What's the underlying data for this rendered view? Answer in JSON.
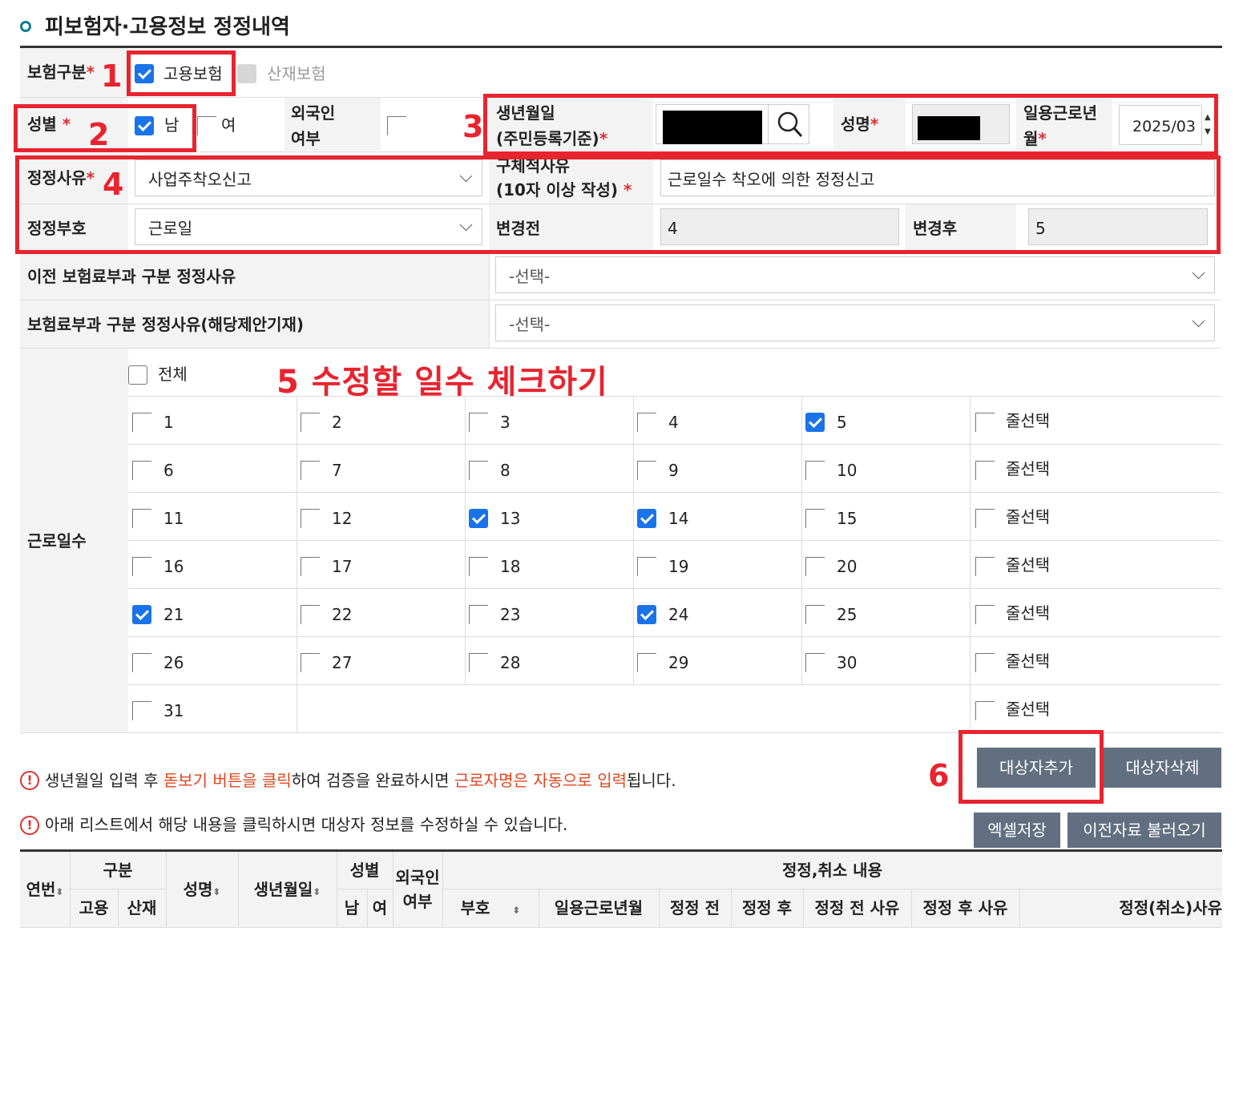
{
  "section": {
    "title": "피보험자·고용정보 정정내역"
  },
  "insurance": {
    "label": "보험구분",
    "required_mark": "*",
    "employment": {
      "label": "고용보험",
      "checked": true
    },
    "industrial": {
      "label": "산재보험",
      "checked": false,
      "disabled": true
    }
  },
  "gender": {
    "label": "성별",
    "required_mark": "*",
    "male": {
      "label": "남",
      "checked": true
    },
    "female": {
      "label": "여",
      "checked": false
    }
  },
  "foreigner": {
    "label_line1": "외국인",
    "label_line2": "여부"
  },
  "birth": {
    "label_line1": "생년월일",
    "label_line2": "(주민등록기준)",
    "required_mark": "*"
  },
  "name_field": {
    "label": "성명",
    "required_mark": "*"
  },
  "work_month": {
    "label_line1": "일용근로년",
    "label_line2": "월",
    "required_mark": "*",
    "value": "2025/03"
  },
  "reason": {
    "label": "정정사유",
    "required_mark": "*",
    "selected": "사업주착오신고"
  },
  "detail_reason": {
    "label_line1": "구체적사유",
    "label_line2": "(10자 이상 작성)",
    "required_mark": "*",
    "value": "근로일수 착오에 의한 정정신고"
  },
  "code": {
    "label": "정정부호",
    "selected": "근로일"
  },
  "before": {
    "label": "변경전",
    "value": "4"
  },
  "after": {
    "label": "변경후",
    "value": "5"
  },
  "prev_reason": {
    "label": "이전 보험료부과 구분 정정사유",
    "selected": "-선택-"
  },
  "cur_reason": {
    "label": "보험료부과 구분 정정사유(해당제안기재)",
    "selected": "-선택-"
  },
  "workdays": {
    "label": "근로일수",
    "all_label": "전체",
    "row_select_label": "줄선택",
    "checked_days": [
      5,
      13,
      14,
      21,
      24
    ],
    "days": [
      "1",
      "2",
      "3",
      "4",
      "5",
      "6",
      "7",
      "8",
      "9",
      "10",
      "11",
      "12",
      "13",
      "14",
      "15",
      "16",
      "17",
      "18",
      "19",
      "20",
      "21",
      "22",
      "23",
      "24",
      "25",
      "26",
      "27",
      "28",
      "29",
      "30",
      "31"
    ]
  },
  "annotations": {
    "n1": "1",
    "n2": "2",
    "n3": "3",
    "n4": "4",
    "n6": "6",
    "step5": "5 수정할 일수 체크하기"
  },
  "notice1": {
    "p1": "생년월일 입력 후 ",
    "h1": "돋보기 버튼을 클릭",
    "p2": "하여 검증을 완료하시면 ",
    "h2": "근로자명은 자동으로 입력",
    "p3": "됩니다."
  },
  "notice2": {
    "text": "아래 리스트에서 해당 내용을 클릭하시면 대상자 정보를 수정하실 수 있습니다."
  },
  "buttons": {
    "add": "대상자추가",
    "delete": "대상자삭제",
    "excel": "엑셀저장",
    "load_prev": "이전자료 불러오기"
  },
  "table": {
    "year": "연번",
    "category": "구분",
    "employment": "고용",
    "industrial": "산재",
    "name": "성명",
    "birth": "생년월일",
    "gender": "성별",
    "male": "남",
    "female": "여",
    "foreigner_l1": "외국인",
    "foreigner_l2": "여부",
    "correction": "정정,취소 내용",
    "code": "부호",
    "work_month": "일용근로년월",
    "before": "정정 전",
    "after": "정정 후",
    "before_reason": "정정 전 사유",
    "after_reason": "정정 후 사유",
    "cancel_reason": "정정(취소)사유"
  }
}
